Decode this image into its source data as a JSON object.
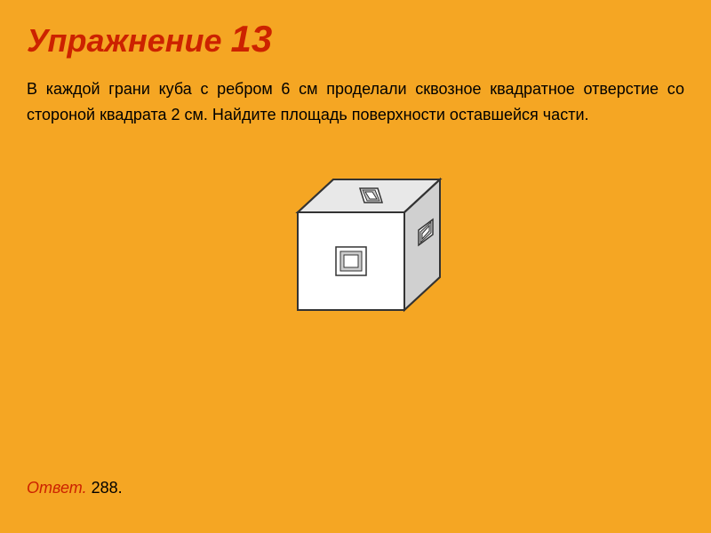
{
  "title": {
    "prefix": "Упражнение",
    "number": "13"
  },
  "problem": {
    "text": "В каждой грани куба с ребром 6 см проделали сквозное квадратное отверстие со стороной квадрата 2 см. Найдите площадь поверхности оставшейся части."
  },
  "answer": {
    "label": "Ответ.",
    "value": " 288."
  },
  "colors": {
    "background": "#F5A623",
    "title": "#CC2200",
    "text": "#000000"
  }
}
